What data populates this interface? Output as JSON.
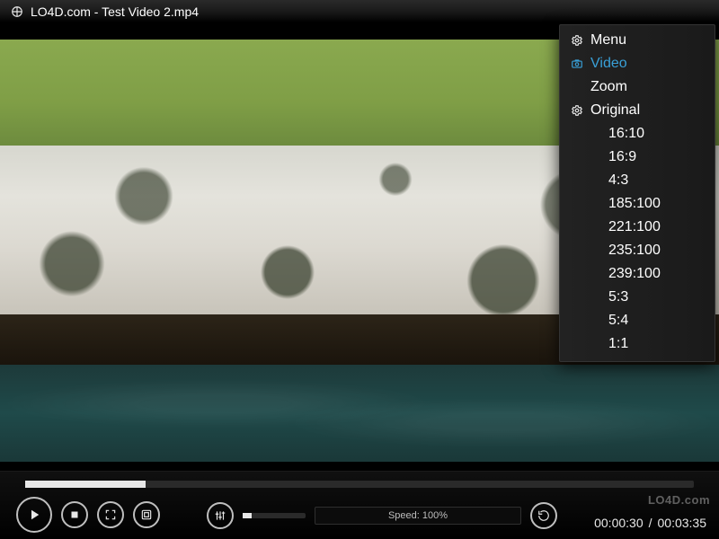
{
  "title": "LO4D.com - Test Video 2.mp4",
  "watermark": "LO4D.com",
  "menu": {
    "header": "Menu",
    "video": "Video",
    "zoom": "Zoom",
    "original": "Original",
    "ratios": [
      "16:10",
      "16:9",
      "4:3",
      "185:100",
      "221:100",
      "235:100",
      "239:100",
      "5:3",
      "5:4",
      "1:1"
    ]
  },
  "playback": {
    "speed_label": "Speed: 100%",
    "progress_pct": 18,
    "volume_pct": 14,
    "elapsed": "00:00:30",
    "duration": "00:03:35"
  }
}
